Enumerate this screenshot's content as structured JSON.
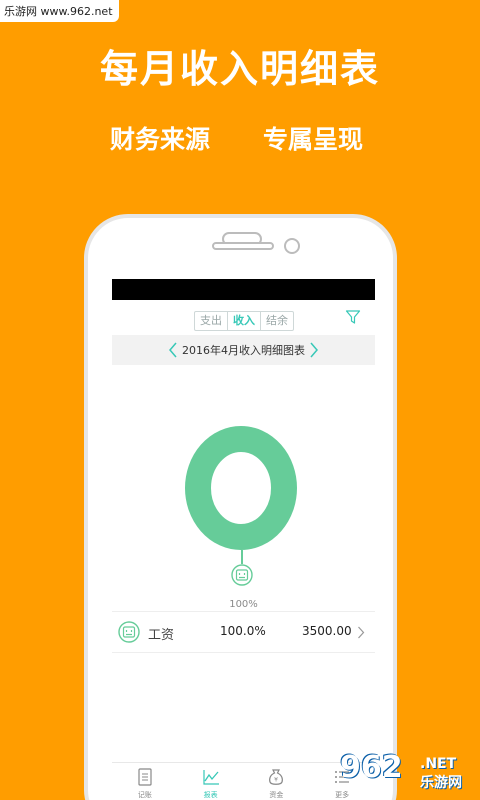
{
  "watermark": {
    "text": "乐游网 www.962.net"
  },
  "promo": {
    "headline": "每月收入明细表",
    "sub_left": "财务来源",
    "sub_right": "专属呈现"
  },
  "app": {
    "segments": [
      {
        "label": "支出",
        "active": false
      },
      {
        "label": "收入",
        "active": true
      },
      {
        "label": "结余",
        "active": false
      }
    ],
    "report_title": "2016年4月收入明细图表",
    "chart_data": {
      "type": "pie",
      "categories": [
        "工资"
      ],
      "values": [
        100.0
      ],
      "labels": [
        "100%"
      ],
      "colors": [
        "#66CC99"
      ]
    },
    "rows": [
      {
        "name": "工资",
        "percent": "100.0%",
        "amount": "3500.00"
      }
    ],
    "tabs": [
      {
        "label": "记账",
        "icon": "notebook-icon",
        "active": false
      },
      {
        "label": "报表",
        "icon": "line-chart-icon",
        "active": true
      },
      {
        "label": "资金",
        "icon": "money-bag-icon",
        "active": false
      },
      {
        "label": "更多",
        "icon": "list-icon",
        "active": false
      }
    ]
  },
  "brand": {
    "big": "962",
    "small_top": ".NET",
    "small_bottom": "乐游网"
  },
  "colors": {
    "background": "#FF9D00",
    "accent": "#37C8B7",
    "donut": "#66CC99"
  }
}
